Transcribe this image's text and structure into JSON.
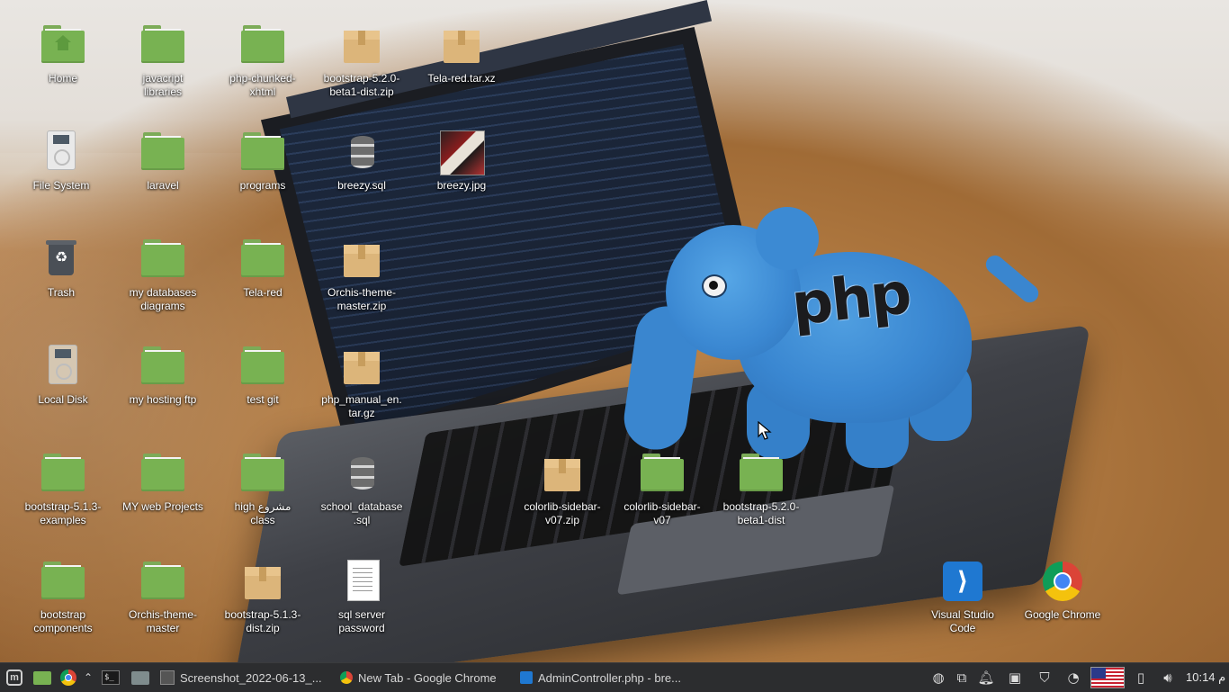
{
  "desktop": {
    "icons": [
      {
        "label": "Home",
        "icon": "home-folder-icon"
      },
      {
        "label": "javacript\nlibraries",
        "icon": "folder-icon"
      },
      {
        "label": "php-chunked-\nxhtml",
        "icon": "folder-icon"
      },
      {
        "label": "bootstrap-5.2.0-\nbeta1-dist.zip",
        "icon": "archive-icon"
      },
      {
        "label": "Tela-red.tar.xz",
        "icon": "archive-icon"
      },
      {
        "label": "File System",
        "icon": "drive-icon"
      },
      {
        "label": "laravel",
        "icon": "folder-icon"
      },
      {
        "label": "programs",
        "icon": "folder-icon"
      },
      {
        "label": "breezy.sql",
        "icon": "database-file-icon"
      },
      {
        "label": "breezy.jpg",
        "icon": "image-file-icon"
      },
      {
        "label": "Trash",
        "icon": "trash-icon"
      },
      {
        "label": "my databases\ndiagrams",
        "icon": "folder-icon"
      },
      {
        "label": "Tela-red",
        "icon": "folder-icon"
      },
      {
        "label": "Orchis-theme-\nmaster.zip",
        "icon": "archive-icon"
      },
      {
        "label": "Local Disk",
        "icon": "disk-icon"
      },
      {
        "label": "my hosting ftp",
        "icon": "folder-icon"
      },
      {
        "label": "test git",
        "icon": "folder-icon"
      },
      {
        "label": "php_manual_en.\ntar.gz",
        "icon": "archive-icon"
      },
      {
        "label": "bootstrap-5.1.3-\nexamples",
        "icon": "folder-icon"
      },
      {
        "label": "MY web Projects",
        "icon": "folder-icon"
      },
      {
        "label": "high مشروع\nclass",
        "icon": "folder-icon"
      },
      {
        "label": "school_database\n.sql",
        "icon": "database-file-icon"
      },
      {
        "label": "colorlib-sidebar-\nv07.zip",
        "icon": "archive-icon"
      },
      {
        "label": "colorlib-sidebar-\nv07",
        "icon": "folder-icon"
      },
      {
        "label": "bootstrap-5.2.0-\nbeta1-dist",
        "icon": "folder-icon"
      },
      {
        "label": "bootstrap\ncomponents",
        "icon": "folder-icon"
      },
      {
        "label": "Orchis-theme-\nmaster",
        "icon": "folder-icon"
      },
      {
        "label": "bootstrap-5.1.3-\ndist.zip",
        "icon": "archive-icon"
      },
      {
        "label": "sql server\npassword",
        "icon": "text-file-icon"
      },
      {
        "label": "Visual Studio\nCode",
        "icon": "vscode-icon"
      },
      {
        "label": "Google Chrome",
        "icon": "chrome-icon"
      }
    ]
  },
  "wallpaper": {
    "logo_text": "php"
  },
  "taskbar": {
    "menu_icon": "linux-mint-menu-icon",
    "quick_launch": [
      {
        "icon": "files-icon"
      },
      {
        "icon": "chrome-icon"
      },
      {
        "icon": "terminal-icon",
        "glyph": "$_"
      }
    ],
    "windows": [
      {
        "icon": "image-viewer-icon",
        "title": "Screenshot_2022-06-13_..."
      },
      {
        "icon": "chrome-icon",
        "title": "New Tab - Google Chrome"
      },
      {
        "icon": "vscode-icon",
        "title": "AdminController.php - bre..."
      }
    ],
    "tray": {
      "clock": "10:14 م",
      "keyboard_layout": "us-flag-icon"
    }
  },
  "colors": {
    "folder": "#78b252",
    "taskbar": "#2c2d2f",
    "elephant": "#3a87d1"
  }
}
